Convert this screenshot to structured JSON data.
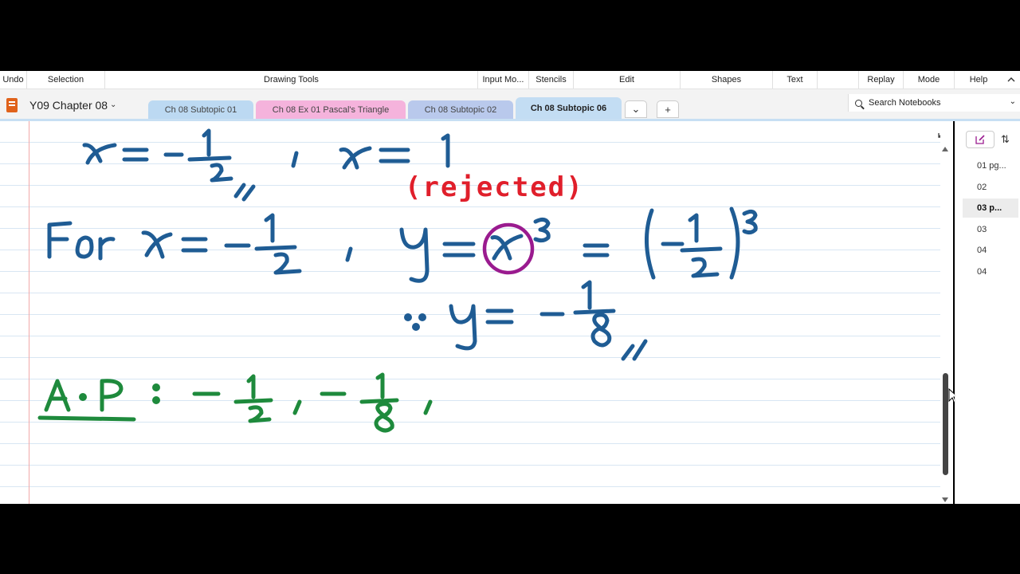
{
  "ribbon": {
    "items": [
      {
        "label": "Undo",
        "width": 34
      },
      {
        "label": "Selection",
        "width": 98
      },
      {
        "label": "Drawing Tools",
        "width": 468
      },
      {
        "label": "Input Mo...",
        "width": 64
      },
      {
        "label": "Stencils",
        "width": 56
      },
      {
        "label": "Edit",
        "width": 134
      },
      {
        "label": "Shapes",
        "width": 116
      },
      {
        "label": "Text",
        "width": 56
      },
      {
        "label": "",
        "width": 52
      },
      {
        "label": "Replay",
        "width": 56
      },
      {
        "label": "Mode",
        "width": 64
      },
      {
        "label": "Help",
        "width": 60
      }
    ],
    "collapse_icon": "chevron-up-icon"
  },
  "notebook": {
    "title": "Y09 Chapter 08",
    "icon": "notebook-icon"
  },
  "tabs": [
    {
      "label": "Ch 08 Subtopic 01",
      "color": "#bcd9f2",
      "active": false
    },
    {
      "label": "Ch 08 Ex 01 Pascal's Triangle",
      "color": "#f5b3dc",
      "active": false
    },
    {
      "label": "Ch 08 Subtopic 02",
      "color": "#b9c9ec",
      "active": false
    },
    {
      "label": "Ch 08 Subtopic 06",
      "color": "#c3ddf3",
      "active": true
    }
  ],
  "tab_more_icon": "chevron-down-icon",
  "tab_add_label": "+",
  "search": {
    "placeholder": "Search Notebooks"
  },
  "pages": [
    {
      "label": "01 pg...",
      "selected": false
    },
    {
      "label": "02",
      "selected": false
    },
    {
      "label": "03 p...",
      "selected": true
    },
    {
      "label": "03",
      "selected": false
    },
    {
      "label": "04",
      "selected": false
    },
    {
      "label": "04",
      "selected": false
    }
  ],
  "ink": {
    "rejected_note": "(rejected)",
    "colors": {
      "blue": "#1f5c94",
      "red": "#e01f2b",
      "green": "#1e8a3c",
      "purple": "#9a1b8f"
    }
  }
}
